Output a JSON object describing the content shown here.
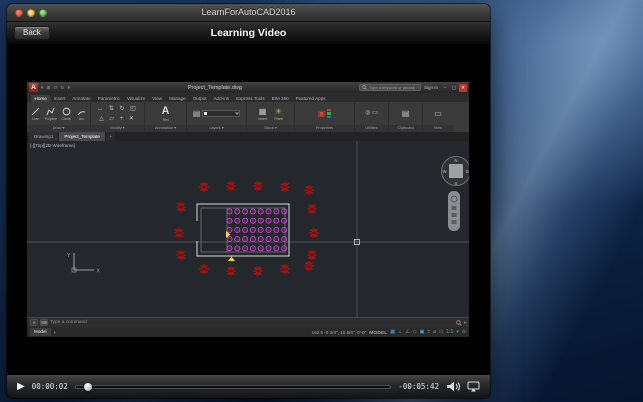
{
  "window": {
    "title": "LearnForAutoCAD2016",
    "nav": {
      "back_label": "Back",
      "title": "Learning Video"
    }
  },
  "player": {
    "elapsed": "00:00:02",
    "remaining": "-00:05:42",
    "progress_percent": 4,
    "icons": {
      "play": "▶"
    }
  },
  "acad": {
    "titlebar": {
      "logo": "A",
      "qat_icons": "▾ ⊞ ↺ ↻ ▾",
      "title": "Project_Template.dwg",
      "search_placeholder": "Type a keyword or phrase",
      "sign_in": "Sign In",
      "win_min": "–",
      "win_restore": "▢",
      "win_close": "✕"
    },
    "ribbon_tabs": [
      "Home",
      "Insert",
      "Annotate",
      "Parametric",
      "Visualize",
      "View",
      "Manage",
      "Output",
      "Add-ins",
      "Express Tools",
      "BIM 360",
      "Featured Apps"
    ],
    "tools": {
      "line": "Line",
      "polyline": "Polyline",
      "circle": "Circle",
      "arc": "Arc",
      "text": "Text",
      "insert": "Insert",
      "plant": "Plant"
    },
    "icons": {
      "modify_row1": "↔ ⇅ ↻ ◰",
      "modify_row2": "△ ▱ + ✕",
      "layers": "▤",
      "insert": "▦",
      "plant": "✳",
      "properties_box": "▣",
      "utilities": "◎ ▭",
      "clipboard": "▤",
      "view": "▭",
      "cmd1": "✕",
      "cmd2": "⌨"
    },
    "panel_labels": {
      "draw": "Draw ▾",
      "modify": "Modify ▾",
      "annotation": "Annotation ▾",
      "layers": "Layers ▾",
      "block": "Block ▾",
      "properties": "Properties",
      "utilities": "Utilities",
      "clipboard": "Clipboard",
      "view": "View"
    },
    "file_tabs": [
      "Drawing1",
      "Project_Template"
    ],
    "new_tab_label": "+",
    "viewport_label": "[-][Top][2D Wireframe]",
    "viewcube": {
      "n": "N",
      "s": "S",
      "e": "E",
      "w": "W"
    },
    "ucs": {
      "x": "X",
      "y": "Y"
    },
    "command_placeholder": "Type a command",
    "statusbar": {
      "model_tab": "Model",
      "new_layout": "+",
      "coords": "162.5 -0 3/4\", 15 5/8\", 0'-0\"",
      "model_toggle": "MODEL",
      "icon_glyphs": [
        "▦",
        "⊥",
        "∠",
        "◇",
        "▣",
        "±",
        "⌀",
        "⊡"
      ],
      "scale": "1:1",
      "menu_icon": "▾",
      "gear_icon": "⊚"
    }
  }
}
